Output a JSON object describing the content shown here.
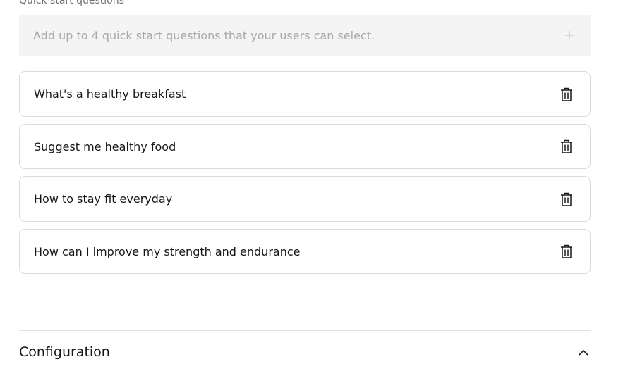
{
  "quick_start": {
    "label": "Quick start questions",
    "add_placeholder": "Add up to 4 quick start questions that your users can select.",
    "add_value": "",
    "add_icon": "plus-icon",
    "delete_icon": "trash-icon",
    "questions": [
      {
        "text": "What's a healthy breakfast"
      },
      {
        "text": "Suggest me healthy food"
      },
      {
        "text": "How to stay fit everyday"
      },
      {
        "text": "How can I improve my strength and endurance"
      }
    ]
  },
  "configuration": {
    "title": "Configuration",
    "state_icon": "chevron-up-icon",
    "expanded": true
  },
  "colors": {
    "text": "#161616",
    "placeholder": "#a8a8a8",
    "field_bg": "#f4f4f4",
    "card_border": "#dcdcdc"
  }
}
